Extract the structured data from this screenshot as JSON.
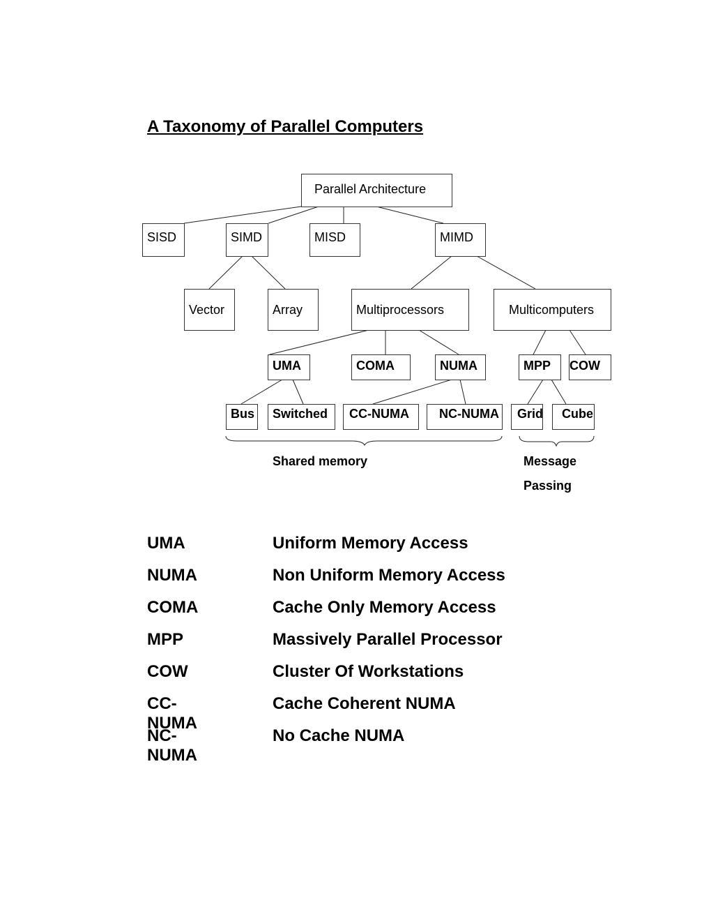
{
  "title": "A Taxonomy of Parallel Computers",
  "nodes": {
    "root": "Parallel Architecture",
    "sisd": "SISD",
    "simd": "SIMD",
    "misd": "MISD",
    "mimd": "MIMD",
    "vector": "Vector",
    "array": "Array",
    "multiprocessors": "Multiprocessors",
    "multicomputers": "Multicomputers",
    "uma": "UMA",
    "coma": "COMA",
    "numa": "NUMA",
    "mpp": "MPP",
    "cow": "COW",
    "bus": "Bus",
    "switched": "Switched",
    "ccnuma": "CC-NUMA",
    "ncnuma": "NC-NUMA",
    "grid": "Grid",
    "cube": "Cube"
  },
  "groups": {
    "shared": "Shared memory",
    "message_line1": "Message",
    "message_line2": "Passing"
  },
  "legend": [
    {
      "abbr": "UMA",
      "full": "Uniform Memory Access"
    },
    {
      "abbr": "NUMA",
      "full": "Non Uniform Memory Access"
    },
    {
      "abbr": "COMA",
      "full": "Cache Only Memory Access"
    },
    {
      "abbr": "MPP",
      "full": "Massively Parallel Processor"
    },
    {
      "abbr": "COW",
      "full": "Cluster Of Workstations"
    },
    {
      "abbr": "CC-NUMA",
      "full": "Cache Coherent NUMA"
    },
    {
      "abbr": "NC-NUMA",
      "full": "No Cache NUMA"
    }
  ]
}
